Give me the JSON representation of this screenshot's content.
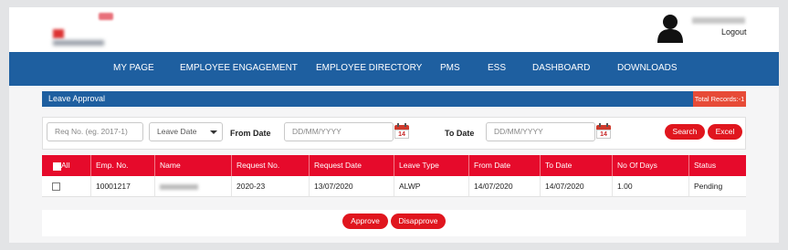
{
  "header": {
    "logout": "Logout"
  },
  "nav": [
    "MY PAGE",
    "EMPLOYEE ENGAGEMENT",
    "EMPLOYEE DIRECTORY",
    "PMS",
    "ESS",
    "DASHBOARD",
    "DOWNLOADS"
  ],
  "panel": {
    "title": "Leave Approval",
    "total_records": "Total Records:-1"
  },
  "filters": {
    "req_placeholder": "Req No. (eg. 2017-1)",
    "leave_type_value": "Leave Date",
    "from_label": "From Date",
    "from_placeholder": "DD/MM/YYYY",
    "to_label": "To Date",
    "to_placeholder": "DD/MM/YYYY",
    "calendar_day": "14",
    "search": "Search",
    "excel": "Excel"
  },
  "table": {
    "all_label": "All",
    "headers": [
      "Emp. No.",
      "Name",
      "Request No.",
      "Request Date",
      "Leave Type",
      "From Date",
      "To Date",
      "No Of Days",
      "Status"
    ],
    "rows": [
      {
        "emp_no": "10001217",
        "request_no": "2020-23",
        "request_date": "13/07/2020",
        "leave_type": "ALWP",
        "from_date": "14/07/2020",
        "to_date": "14/07/2020",
        "days": "1.00",
        "status": "Pending"
      }
    ]
  },
  "actions": {
    "approve": "Approve",
    "disapprove": "Disapprove"
  },
  "colors": {
    "nav_blue": "#1e5fa0",
    "table_red": "#e60a2b",
    "button_red": "#e0161e",
    "total_badge": "#e74b37"
  }
}
